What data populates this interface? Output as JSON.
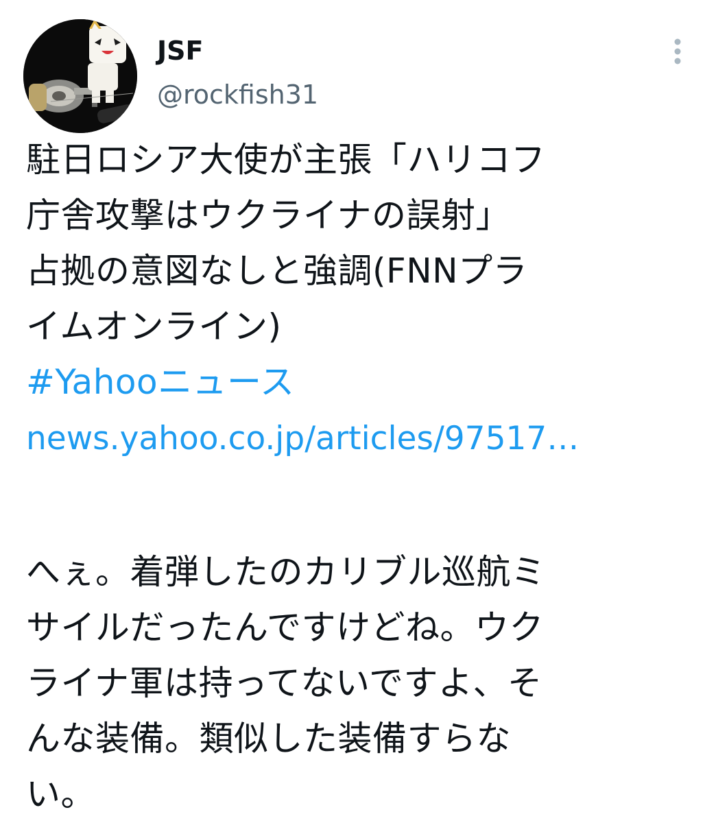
{
  "author": {
    "display_name": "JSF",
    "handle": "@rockfish31"
  },
  "more_icon": "more-vertical-icon",
  "colors": {
    "link": "#1d9bf0",
    "handle": "#536471",
    "text": "#0f1419"
  },
  "tweet": {
    "headline_lines": [
      "駐日ロシア大使が主張「ハリコフ",
      "庁舎攻撃はウクライナの誤射」",
      "占拠の意図なしと強調(FNNプラ",
      "イムオンライン)"
    ],
    "hashtag": "#Yahooニュース",
    "url": "news.yahoo.co.jp/articles/97517…",
    "comment_lines": [
      "へぇ。着弾したのカリブル巡航ミ",
      "サイルだったんですけどね。ウク",
      "ライナ軍は持ってないですよ、そ",
      "んな装備。類似した装備すらな",
      "い。"
    ]
  }
}
